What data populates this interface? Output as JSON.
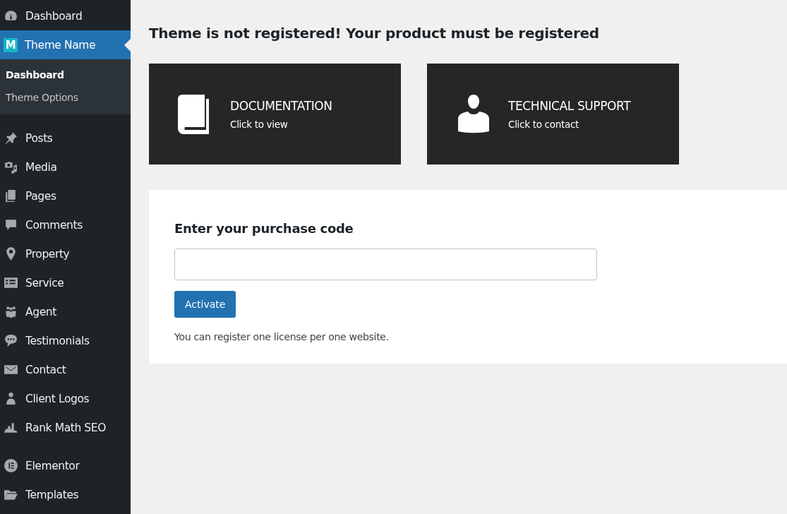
{
  "sidebar": {
    "groups": [
      {
        "items": [
          {
            "label": "Dashboard",
            "selected": false
          },
          {
            "label": "Theme Name",
            "selected": true,
            "logo": "M",
            "children": [
              {
                "label": "Dashboard",
                "selected": true
              },
              {
                "label": "Theme Options",
                "selected": false
              }
            ]
          }
        ]
      },
      {
        "items": [
          {
            "label": "Posts",
            "selected": false
          },
          {
            "label": "Media",
            "selected": false
          },
          {
            "label": "Pages",
            "selected": false
          },
          {
            "label": "Comments",
            "selected": false
          },
          {
            "label": "Property",
            "selected": false
          },
          {
            "label": "Service",
            "selected": false
          },
          {
            "label": "Agent",
            "selected": false
          },
          {
            "label": "Testimonials",
            "selected": false
          },
          {
            "label": "Contact",
            "selected": false
          },
          {
            "label": "Client Logos",
            "selected": false
          },
          {
            "label": "Rank Math SEO",
            "selected": false
          }
        ]
      },
      {
        "items": [
          {
            "label": "Elementor",
            "selected": false
          },
          {
            "label": "Templates",
            "selected": false
          }
        ]
      }
    ]
  },
  "main": {
    "heading": "Theme is not registered! Your product must be registered",
    "cards": [
      {
        "kind": "book",
        "title": "DOCUMENTATION",
        "subtitle": "Click to view"
      },
      {
        "kind": "person",
        "title": "TECHNICAL SUPPORT",
        "subtitle": "Click to contact"
      }
    ],
    "registration": {
      "label": "Enter your purchase code",
      "button": "Activate",
      "note": "You can register one license per one website."
    }
  }
}
